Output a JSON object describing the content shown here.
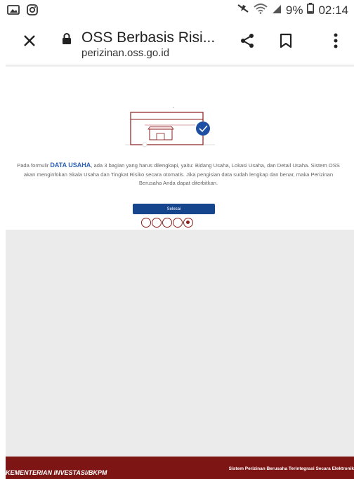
{
  "status_bar": {
    "left_icons": [
      "image-icon",
      "instagram-icon"
    ],
    "right_icons": [
      "mute-icon",
      "wifi-icon",
      "signal-icon",
      "battery-icon"
    ],
    "battery": "9%",
    "time": "02:14"
  },
  "browser_toolbar": {
    "title": "OSS Berbasis Risi...",
    "url": "perizinan.oss.go.id"
  },
  "content": {
    "description_pre": "Pada formulir ",
    "description_highlight": "DATA USAHA",
    "description_post": ", ada 3 bagian yang harus dilengkapi, yaitu: Bidang Usaha, Lokasi Usaha, dan Detail Usaha. Sistem OSS akan menginfokan Skala Usaha dan Tingkat Risiko secara otomatis. Jika pengisian data sudah lengkap dan benar, maka Perizinan Berusaha Anda dapat diterbitkan.",
    "button_label": "Selesai",
    "steps_total": 5,
    "steps_active_index": 5
  },
  "footer": {
    "left": "KEMENTERIAN INVESTASI/BKPM",
    "right": "Sistem Perizinan Berusaha Terintegrasi Secara Elektronik"
  },
  "colors": {
    "accent_red": "#8a1c1c",
    "button_blue": "#15468d",
    "footer_red": "#7e1515",
    "highlight_blue": "#2b5fb5"
  }
}
